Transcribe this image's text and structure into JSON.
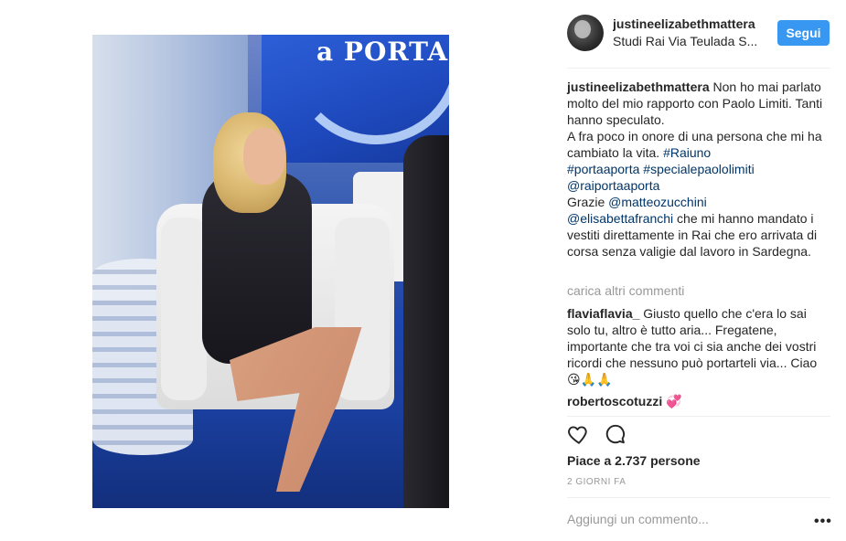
{
  "post": {
    "username": "justineelizabethmattera",
    "location": "Studi Rai Via Teulada S...",
    "follow_label": "Segui",
    "caption": {
      "author": "justineelizabethmattera",
      "text_1": "Non ho mai parlato molto del mio rapporto con Paolo Limiti. Tanti hanno speculato.",
      "text_2": "A fra poco in onore di una persona che mi ha cambiato la vita. ",
      "tag_raiuno": "#Raiuno",
      "tag_portaaporta": "#portaaporta",
      "tag_speciale": "#specialepaololimiti",
      "mention_rai": "@raiportaaporta",
      "grazie": "Grazie ",
      "mention_matteo": "@matteozucchini",
      "mention_elisabetta": "@elisabettafranchi",
      "text_3": " che mi hanno mandato i vestiti direttamente in Rai che ero arrivata di corsa senza valigie dal lavoro in Sardegna."
    },
    "load_more": "carica altri commenti",
    "comments": [
      {
        "author": "flaviaflavia_",
        "text": " Giusto quello che c'era lo sai solo tu, altro è tutto aria... Fregatene, importante che tra voi ci sia anche dei vostri ricordi che nessuno può portarteli via... Ciao ",
        "emoji": "😘🙏🙏"
      },
      {
        "author": "robertoscotuzzi",
        "text": " ",
        "emoji": "💞"
      }
    ],
    "likes": "Piace a 2.737 persone",
    "time": "2 GIORNI FA",
    "add_comment_placeholder": "Aggiungi un commento...",
    "more_options": "•••"
  },
  "icons": {
    "like": "heart-outline-icon",
    "comment": "speech-bubble-icon",
    "options": "more-options-icon"
  },
  "colors": {
    "follow": "#3897f0",
    "link": "#003569",
    "muted": "#999999",
    "text": "#262626"
  },
  "photo": {
    "screen_text": "a PORTA"
  }
}
